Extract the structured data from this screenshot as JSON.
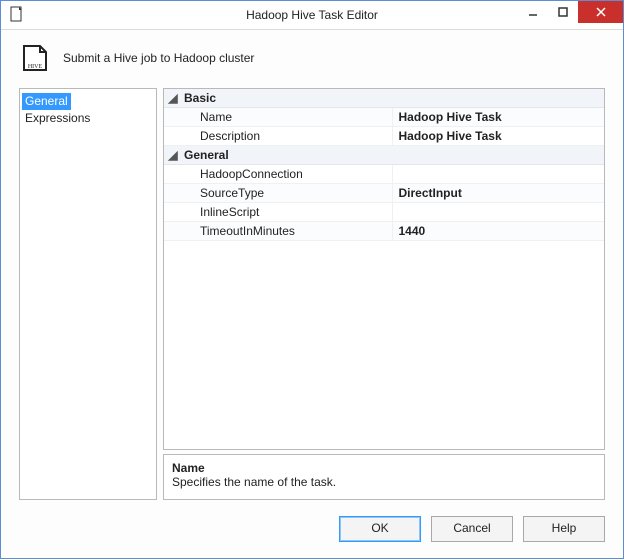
{
  "window": {
    "title": "Hadoop Hive Task Editor"
  },
  "header": {
    "subtitle": "Submit a Hive job to Hadoop cluster",
    "icon_label": "HIVE"
  },
  "sidebar": {
    "items": [
      {
        "label": "General",
        "selected": true
      },
      {
        "label": "Expressions",
        "selected": false
      }
    ]
  },
  "grid": {
    "categories": [
      {
        "name": "Basic",
        "props": [
          {
            "name": "Name",
            "value": "Hadoop Hive Task",
            "bold": true
          },
          {
            "name": "Description",
            "value": "Hadoop Hive Task",
            "bold": true
          }
        ]
      },
      {
        "name": "General",
        "props": [
          {
            "name": "HadoopConnection",
            "value": "",
            "bold": false
          },
          {
            "name": "SourceType",
            "value": "DirectInput",
            "bold": true
          },
          {
            "name": "InlineScript",
            "value": "",
            "bold": false
          },
          {
            "name": "TimeoutInMinutes",
            "value": "1440",
            "bold": true
          }
        ]
      }
    ]
  },
  "help": {
    "title": "Name",
    "desc": "Specifies the name of the task."
  },
  "footer": {
    "ok": "OK",
    "cancel": "Cancel",
    "help": "Help"
  }
}
